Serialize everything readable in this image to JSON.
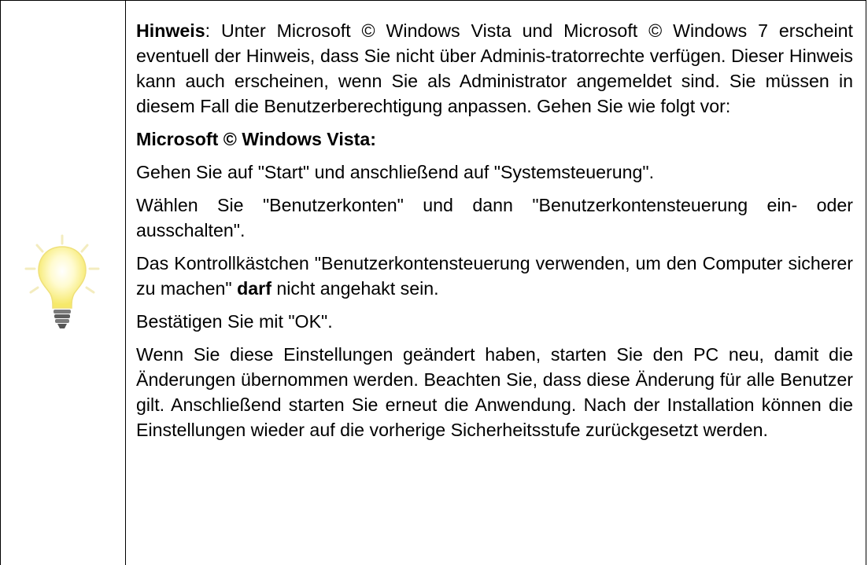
{
  "note": {
    "hint_label": "Hinweis",
    "hint_text": ": Unter Microsoft © Windows Vista und Microsoft © Windows 7 erscheint eventuell der Hinweis, dass Sie nicht über Adminis-tratorrechte verfügen. Dieser Hinweis kann auch erscheinen, wenn Sie als Administrator angemeldet sind. Sie müssen in diesem Fall die Benutzerberechtigung anpassen. Gehen Sie wie folgt vor:",
    "vista_heading": "Microsoft © Windows Vista:",
    "step1": "Gehen Sie auf \"Start\" und anschließend auf \"Systemsteuerung\".",
    "step2": "Wählen Sie \"Benutzerkonten\" und dann \"Benutzerkontensteuerung ein- oder ausschalten\".",
    "step3_before": "Das Kontrollkästchen \"Benutzerkontensteuerung verwenden, um den Computer sicherer zu machen\" ",
    "step3_bold": "darf",
    "step3_after": " nicht angehakt sein.",
    "step4": "Bestätigen Sie mit \"OK\".",
    "final": "Wenn Sie diese Einstellungen geändert haben, starten Sie den PC neu, damit die Änderungen übernommen werden. Beachten Sie, dass diese Änderung für alle Benutzer gilt. Anschließend starten Sie erneut die Anwendung. Nach der Installation können die Einstellungen wieder auf die vorherige Sicherheitsstufe zurückgesetzt werden."
  },
  "icon": {
    "name": "lightbulb-icon",
    "glow_color": "#fff4a0",
    "bulb_color": "#fffbd0",
    "ray_color": "#f5eec0",
    "base_color": "#6b6b6b"
  }
}
